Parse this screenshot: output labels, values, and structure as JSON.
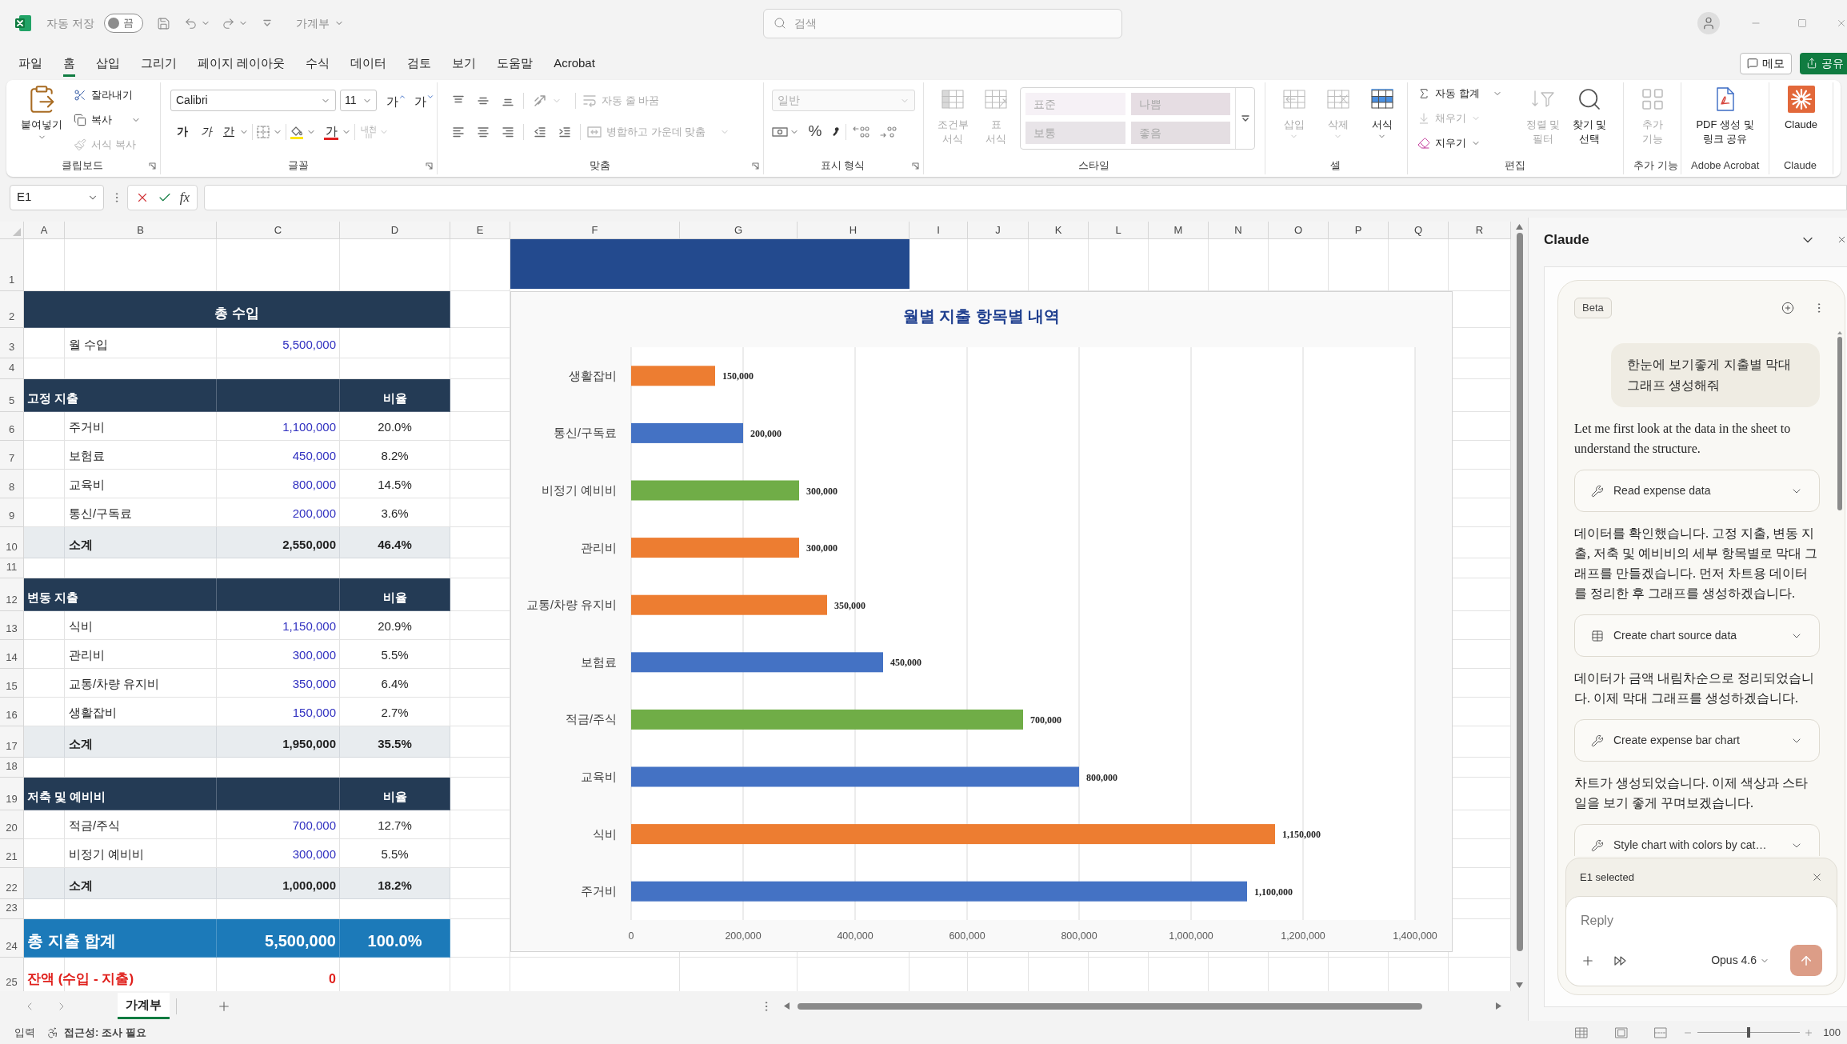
{
  "title_bar": {
    "autosave": {
      "label": "자동 저장",
      "on": false,
      "state_label": "끔"
    },
    "document_name": "가계부",
    "search": {
      "placeholder": "검색"
    }
  },
  "menu": {
    "tabs": [
      {
        "label": "파일",
        "selected": false
      },
      {
        "label": "홈",
        "selected": true
      },
      {
        "label": "삽입",
        "selected": false
      },
      {
        "label": "그리기",
        "selected": false
      },
      {
        "label": "페이지 레이아웃",
        "selected": false
      },
      {
        "label": "수식",
        "selected": false
      },
      {
        "label": "데이터",
        "selected": false
      },
      {
        "label": "검토",
        "selected": false
      },
      {
        "label": "보기",
        "selected": false
      },
      {
        "label": "도움말",
        "selected": false
      },
      {
        "label": "Acrobat",
        "selected": false
      }
    ],
    "comments_button": "메모",
    "share_button": "공유"
  },
  "ribbon": {
    "clipboard": {
      "label": "클립보드",
      "paste": {
        "label": "붙여넣기",
        "disabled": false
      },
      "cut": {
        "label": "잘라내기",
        "disabled": false
      },
      "copy": {
        "label": "복사",
        "disabled": false
      },
      "format_painter": {
        "label": "서식 복사",
        "disabled": true
      }
    },
    "font": {
      "label": "글꼴",
      "font_name": "Calibri",
      "font_size": "11",
      "grow_font": "가",
      "shrink_font": "가",
      "bold": "가",
      "italic": "가",
      "underline": "간",
      "font_color": "가",
      "phonetic_guide": {
        "label": "내천",
        "disabled": true
      }
    },
    "alignment": {
      "label": "맞춤",
      "wrap_text": {
        "label": "자동 줄 바꿈",
        "disabled": true
      },
      "merge_center": {
        "label": "병합하고 가운데 맞춤",
        "disabled": true
      }
    },
    "number": {
      "label": "표시 형식",
      "format": {
        "value": "일반",
        "disabled": true
      },
      "percent": "%"
    },
    "styles": {
      "label": "스타일",
      "conditional_formatting": {
        "label": "조건부\n서식",
        "disabled": true
      },
      "format_as_table": {
        "label": "표\n서식",
        "disabled": true
      },
      "cell_styles": {
        "disabled": true,
        "items": [
          {
            "label": "표준",
            "color": "#f6f1f6"
          },
          {
            "label": "나쁨",
            "color": "#e6dde3"
          },
          {
            "label": "보통",
            "color": "#e8e4e8"
          },
          {
            "label": "좋음",
            "color": "#e4dee2"
          }
        ]
      }
    },
    "cells": {
      "label": "셀",
      "insert": {
        "label": "삽입",
        "disabled": true
      },
      "delete": {
        "label": "삭제",
        "disabled": true
      },
      "format": {
        "label": "서식",
        "disabled": false
      }
    },
    "editing": {
      "label": "편집",
      "autosum": {
        "label": "자동 합계",
        "disabled": false
      },
      "fill": {
        "label": "채우기",
        "disabled": true
      },
      "clear": {
        "label": "지우기",
        "disabled": false
      },
      "sort_filter": {
        "label": "정렬 및\n필터",
        "disabled": true
      },
      "find_select": {
        "label": "찾기 및\n선택",
        "disabled": false
      }
    },
    "add_ins": {
      "label": "추가 기능",
      "button": {
        "label": "추가\n기능",
        "disabled": true
      }
    },
    "acrobat": {
      "label": "Adobe Acrobat",
      "button": {
        "label": "PDF 생성 및\n링크 공유",
        "disabled": false
      }
    },
    "claude": {
      "label": "Claude",
      "button": {
        "label": "Claude",
        "disabled": false
      }
    }
  },
  "formula_bar": {
    "name_box": "E1",
    "insert_function": "fx"
  },
  "sheet": {
    "columns": [
      "A",
      "B",
      "C",
      "D",
      "E",
      "F",
      "G",
      "H",
      "I",
      "J",
      "K",
      "L",
      "M",
      "N",
      "O",
      "P",
      "Q",
      "R"
    ],
    "rows": [
      {
        "number": "1",
        "kind": "blank"
      },
      {
        "number": "2",
        "kind": "title",
        "label": "총 수입"
      },
      {
        "number": "3",
        "kind": "item",
        "label": "월 수입",
        "amount": "5,500,000"
      },
      {
        "number": "4",
        "kind": "blank"
      },
      {
        "number": "5",
        "kind": "section",
        "label": "고정 지출",
        "ratio_header": "비율"
      },
      {
        "number": "6",
        "kind": "item",
        "label": "주거비",
        "amount": "1,100,000",
        "ratio": "20.0%"
      },
      {
        "number": "7",
        "kind": "item",
        "label": "보험료",
        "amount": "450,000",
        "ratio": "8.2%"
      },
      {
        "number": "8",
        "kind": "item",
        "label": "교육비",
        "amount": "800,000",
        "ratio": "14.5%"
      },
      {
        "number": "9",
        "kind": "item",
        "label": "통신/구독료",
        "amount": "200,000",
        "ratio": "3.6%"
      },
      {
        "number": "10",
        "kind": "subtotal",
        "label": "소계",
        "amount": "2,550,000",
        "ratio": "46.4%"
      },
      {
        "number": "11",
        "kind": "blank"
      },
      {
        "number": "12",
        "kind": "section",
        "label": "변동 지출",
        "ratio_header": "비율"
      },
      {
        "number": "13",
        "kind": "item",
        "label": "식비",
        "amount": "1,150,000",
        "ratio": "20.9%"
      },
      {
        "number": "14",
        "kind": "item",
        "label": "관리비",
        "amount": "300,000",
        "ratio": "5.5%"
      },
      {
        "number": "15",
        "kind": "item",
        "label": "교통/차량 유지비",
        "amount": "350,000",
        "ratio": "6.4%"
      },
      {
        "number": "16",
        "kind": "item",
        "label": "생활잡비",
        "amount": "150,000",
        "ratio": "2.7%"
      },
      {
        "number": "17",
        "kind": "subtotal",
        "label": "소계",
        "amount": "1,950,000",
        "ratio": "35.5%"
      },
      {
        "number": "18",
        "kind": "blank"
      },
      {
        "number": "19",
        "kind": "section",
        "label": "저축 및 예비비",
        "ratio_header": "비율"
      },
      {
        "number": "20",
        "kind": "item",
        "label": "적금/주식",
        "amount": "700,000",
        "ratio": "12.7%"
      },
      {
        "number": "21",
        "kind": "item",
        "label": "비정기 예비비",
        "amount": "300,000",
        "ratio": "5.5%"
      },
      {
        "number": "22",
        "kind": "subtotal",
        "label": "소계",
        "amount": "1,000,000",
        "ratio": "18.2%"
      },
      {
        "number": "23",
        "kind": "blank"
      },
      {
        "number": "24",
        "kind": "total",
        "label": "총 지출 합계",
        "amount": "5,500,000",
        "ratio": "100.0%"
      },
      {
        "number": "25",
        "kind": "balance",
        "label": "잔액 (수입 - 지출)",
        "amount": "0"
      }
    ]
  },
  "chart": {
    "chart_data": {
      "type": "bar",
      "orientation": "horizontal",
      "title": "월별 지출 항목별 내역",
      "categories": [
        "생활잡비",
        "통신/구독료",
        "비정기 예비비",
        "관리비",
        "교통/차량 유지비",
        "보험료",
        "적금/주식",
        "교육비",
        "식비",
        "주거비"
      ],
      "series": [
        {
          "color": "#ed7d31",
          "values": [
            150000,
            null,
            null,
            300000,
            350000,
            null,
            null,
            null,
            1150000,
            null
          ],
          "value_labels": [
            "150,000",
            null,
            null,
            "300,000",
            "350,000",
            null,
            null,
            null,
            "1,150,000",
            null
          ]
        },
        {
          "color": "#4472c4",
          "values": [
            null,
            200000,
            null,
            null,
            null,
            450000,
            null,
            800000,
            null,
            1100000
          ],
          "value_labels": [
            null,
            "200,000",
            null,
            null,
            null,
            "450,000",
            null,
            "800,000",
            null,
            "1,100,000"
          ]
        },
        {
          "color": "#70ad47",
          "values": [
            null,
            null,
            300000,
            null,
            null,
            null,
            700000,
            null,
            null,
            null
          ],
          "value_labels": [
            null,
            null,
            "300,000",
            null,
            null,
            null,
            "700,000",
            null,
            null,
            null
          ]
        }
      ],
      "xlim": [
        0,
        1400000
      ],
      "xticks": [
        0,
        {
          "value": 200000,
          "label": "200,000"
        },
        {
          "value": 400000,
          "label": "400,000"
        },
        {
          "value": 600000,
          "label": "600,000"
        },
        {
          "value": 800000,
          "label": "800,000"
        },
        {
          "value": 1000000,
          "label": "1,000,000"
        },
        {
          "value": 1200000,
          "label": "1,200,000"
        },
        {
          "value": 1400000,
          "label": "1,400,000"
        }
      ],
      "grid": true
    }
  },
  "sheet_tabs": [
    {
      "label": "가계부",
      "selected": true
    }
  ],
  "claude_panel": {
    "title": "Claude",
    "badge": "Beta",
    "messages": [
      {
        "kind": "user",
        "text": "한눈에 보기좋게 지출별 막대 그래프 생성해줘"
      },
      {
        "kind": "assistant",
        "text": "Let me first look at the data in the sheet to understand the structure."
      },
      {
        "kind": "tool",
        "label": "Read expense data",
        "expanded": false
      },
      {
        "kind": "assistant",
        "text": "데이터를 확인했습니다. 고정 지출, 변동 지출, 저축 및 예비비의 세부 항목별로 막대 그래프를 만들겠습니다. 먼저 차트용 데이터를 정리한 후 그래프를 생성하겠습니다."
      },
      {
        "kind": "table_tool",
        "label": "Create chart source data",
        "expanded": false
      },
      {
        "kind": "assistant",
        "text": "데이터가 금액 내림차순으로 정리되었습니다. 이제 막대 그래프를 생성하겠습니다."
      },
      {
        "kind": "tool",
        "label": "Create expense bar chart",
        "expanded": false
      },
      {
        "kind": "assistant",
        "text": "차트가 생성되었습니다. 이제 색상과 스타일을 보기 좋게 꾸며보겠습니다."
      },
      {
        "kind": "tool",
        "label": "Style chart with colors by cat…",
        "expanded": false
      }
    ],
    "context_chip": {
      "label": "E1 selected"
    },
    "reply": {
      "placeholder": "Reply"
    },
    "model": "Opus 4.6"
  },
  "status_bar": {
    "mode": "입력",
    "accessibility": "접근성: 조사 필요",
    "zoom": {
      "level": 0.5,
      "reading": "100"
    }
  }
}
